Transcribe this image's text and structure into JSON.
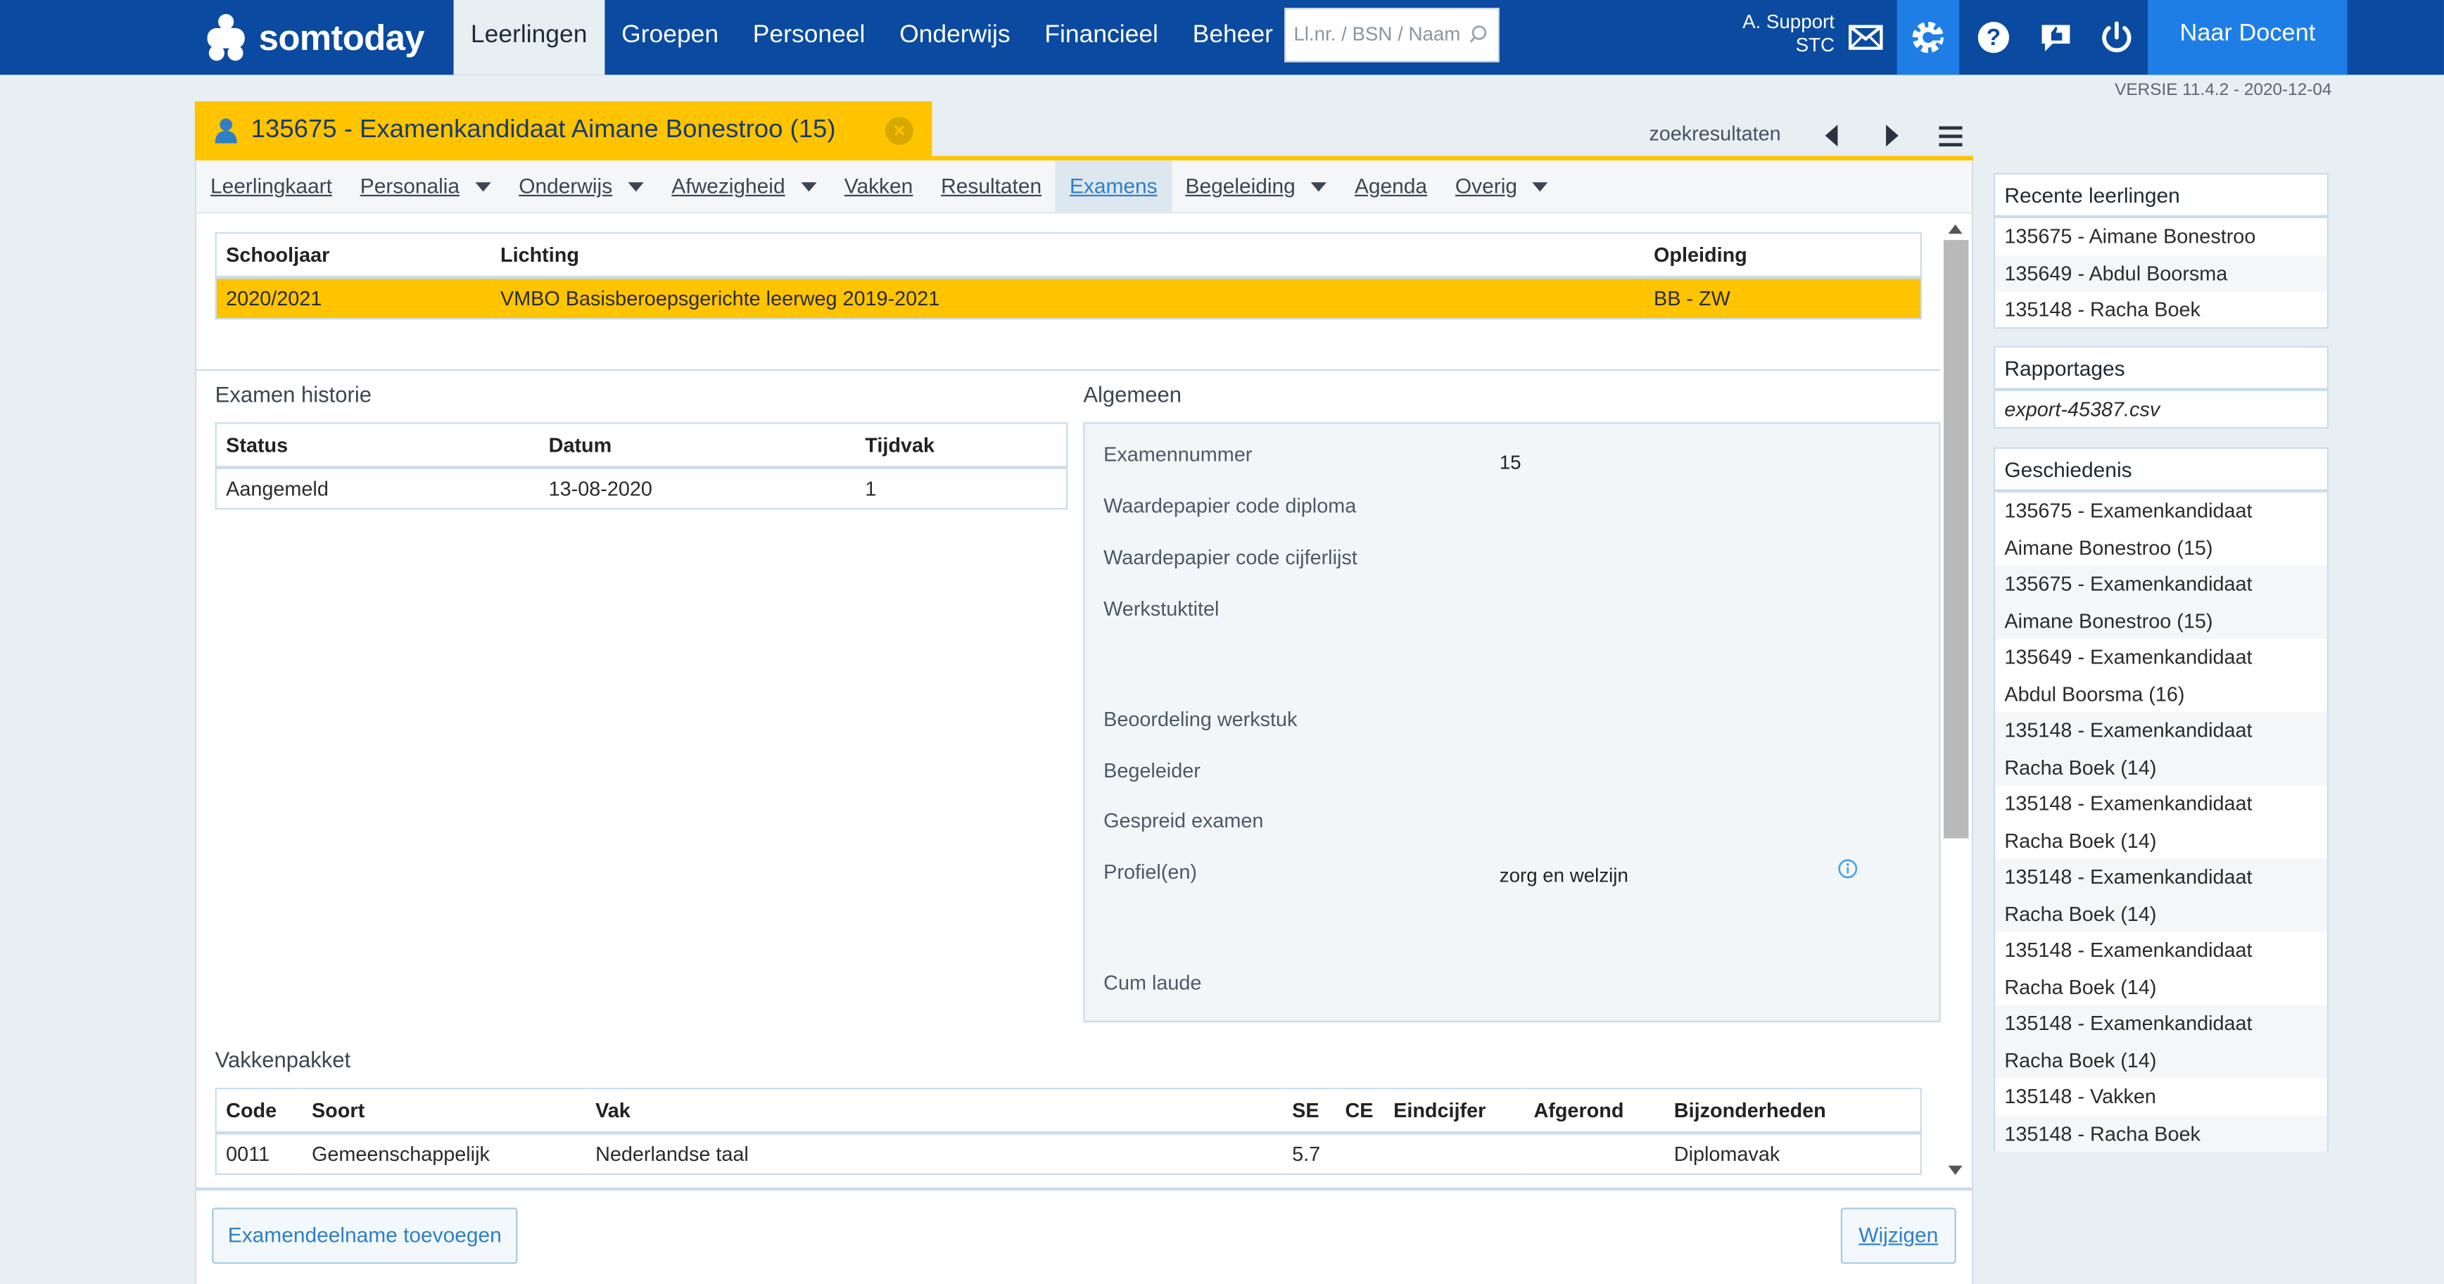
{
  "app": {
    "logo_text": "somtoday",
    "nav": [
      "Leerlingen",
      "Groepen",
      "Personeel",
      "Onderwijs",
      "Financieel",
      "Beheer"
    ],
    "search_placeholder": "Ll.nr. / BSN / Naam",
    "user_line1": "A. Support",
    "user_line2": "STC",
    "naar_docent": "Naar Docent",
    "versie": "VERSIE 11.4.2 - 2020-12-04"
  },
  "student": {
    "title": "135675 - Examenkandidaat Aimane Bonestroo (15)",
    "zoekresultaten": "zoekresultaten"
  },
  "subnav": [
    "Leerlingkaart",
    "Personalia",
    "Onderwijs",
    "Afwezigheid",
    "Vakken",
    "Resultaten",
    "Examens",
    "Begeleiding",
    "Agenda",
    "Overig"
  ],
  "lichting_table": {
    "headers": [
      "Schooljaar",
      "Lichting",
      "Opleiding"
    ],
    "row": [
      "2020/2021",
      "VMBO Basisberoepsgerichte leerweg 2019-2021",
      "BB - ZW"
    ]
  },
  "historie": {
    "title": "Examen historie",
    "headers": [
      "Status",
      "Datum",
      "Tijdvak"
    ],
    "row": [
      "Aangemeld",
      "13-08-2020",
      "1"
    ]
  },
  "algemeen": {
    "title": "Algemeen",
    "labels": {
      "examennummer": "Examennummer",
      "wp_diploma": "Waardepapier code diploma",
      "wp_cijferlijst": "Waardepapier code cijferlijst",
      "werkstuktitel": "Werkstuktitel",
      "beoordeling": "Beoordeling werkstuk",
      "begeleider": "Begeleider",
      "gespreid": "Gespreid examen",
      "profielen": "Profiel(en)",
      "cumlaude": "Cum laude"
    },
    "values": {
      "examennummer": "15",
      "profielen": "zorg en welzijn"
    }
  },
  "vakkenpakket": {
    "title": "Vakkenpakket",
    "headers": [
      "Code",
      "Soort",
      "Vak",
      "SE",
      "CE",
      "Eindcijfer",
      "Afgerond",
      "Bijzonderheden"
    ],
    "row": [
      "0011",
      "Gemeenschappelijk",
      "Nederlandse taal",
      "5.7",
      "",
      "",
      "",
      "Diplomavak"
    ]
  },
  "footer": {
    "add_button": "Examendeelname toevoegen",
    "edit_button": "Wijzigen"
  },
  "sidebar": {
    "recent": {
      "title": "Recente leerlingen",
      "items": [
        "135675 - Aimane Bonestroo",
        "135649 - Abdul Boorsma",
        "135148 - Racha Boek"
      ]
    },
    "rapportages": {
      "title": "Rapportages",
      "items": [
        "export-45387.csv"
      ]
    },
    "geschiedenis": {
      "title": "Geschiedenis",
      "items": [
        "135675 - Examenkandidaat",
        "Aimane Bonestroo (15)",
        "135675 - Examenkandidaat",
        "Aimane Bonestroo (15)",
        "135649 - Examenkandidaat",
        "Abdul Boorsma (16)",
        "135148 - Examenkandidaat",
        "Racha Boek (14)",
        "135148 - Examenkandidaat",
        "Racha Boek (14)",
        "135148 - Examenkandidaat",
        "Racha Boek (14)",
        "135148 - Examenkandidaat",
        "Racha Boek (14)",
        "135148 - Examenkandidaat",
        "Racha Boek (14)",
        "135148 - Vakken",
        "135148 - Racha Boek"
      ]
    }
  },
  "colors": {
    "brand": "#0a4aa0",
    "accent": "#1f7ee6",
    "highlight": "#ffc400"
  },
  "icons": [
    "somtoday-logo",
    "search-icon",
    "mail-icon",
    "gear-icon",
    "help-icon",
    "thumbs-up-icon",
    "power-icon",
    "user-icon",
    "close-icon",
    "arrow-left-icon",
    "arrow-right-icon",
    "menu-icon",
    "info-icon"
  ]
}
